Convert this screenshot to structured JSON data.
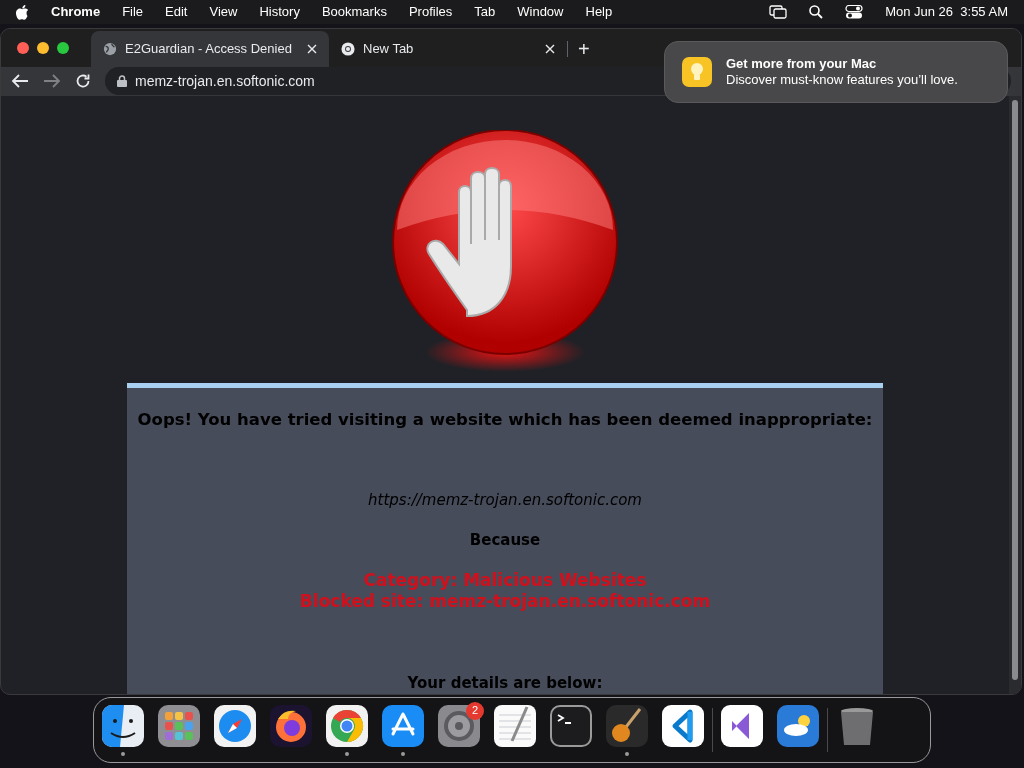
{
  "menubar": {
    "app": "Chrome",
    "items": [
      "File",
      "Edit",
      "View",
      "History",
      "Bookmarks",
      "Profiles",
      "Tab",
      "Window",
      "Help"
    ],
    "clock": "Mon Jun 26  3:55 AM"
  },
  "tabs": [
    {
      "title": "E2Guardian - Access Denied",
      "selected": true,
      "kind": "blocked-page"
    },
    {
      "title": "New Tab",
      "selected": false,
      "kind": "new-tab"
    }
  ],
  "new_tab": "+",
  "address": "memz-trojan.en.softonic.com",
  "notification": {
    "title": "Get more from your Mac",
    "body": "Discover must-know features you’ll love."
  },
  "page": {
    "heading": "Oops! You have tried visiting a website which has been deemed inappropriate:",
    "url": "https://memz-trojan.en.softonic.com",
    "because": "Because",
    "reasons": [
      "Category: Malicious Websites",
      "Blocked site: memz-trojan.en.softonic.com"
    ],
    "details": "Your details are below:"
  },
  "dock": [
    [
      {
        "kind": "finder",
        "running": true
      },
      {
        "kind": "launchpad",
        "running": false
      },
      {
        "kind": "safari",
        "running": false
      },
      {
        "kind": "firefox",
        "running": false
      },
      {
        "kind": "chrome",
        "running": true
      },
      {
        "kind": "appstore",
        "running": true
      },
      {
        "kind": "settings",
        "running": false,
        "badge": "2"
      },
      {
        "kind": "textedit",
        "running": false
      },
      {
        "kind": "terminal",
        "running": false
      },
      {
        "kind": "garageband",
        "running": true
      },
      {
        "kind": "vscode",
        "running": false
      }
    ],
    [
      {
        "kind": "visualstudio",
        "running": false
      },
      {
        "kind": "weather",
        "running": false
      }
    ],
    [
      {
        "kind": "trash",
        "running": false
      }
    ]
  ]
}
